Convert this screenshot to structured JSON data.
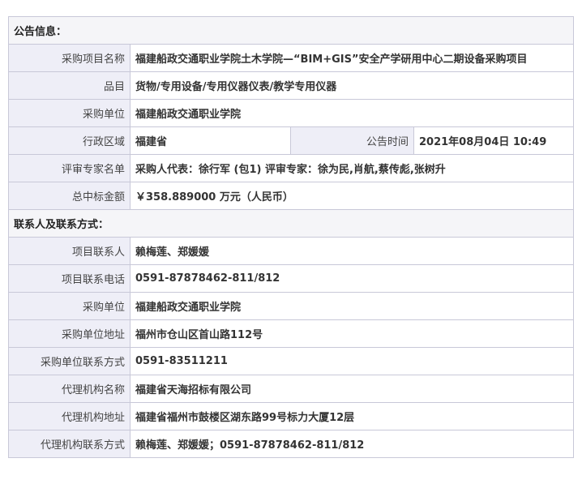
{
  "announcement": {
    "section_title": "公告信息：",
    "project_name_label": "采购项目名称",
    "project_name": "福建船政交通职业学院土木学院—“BIM+GIS”安全产学研用中心二期设备采购项目",
    "category_label": "品目",
    "category": "货物/专用设备/专用仪器仪表/教学专用仪器",
    "buyer_label": "采购单位",
    "buyer": "福建船政交通职业学院",
    "region_label": "行政区域",
    "region": "福建省",
    "publish_time_label": "公告时间",
    "publish_time": "2021年08月04日 10:49",
    "experts_label": "评审专家名单",
    "experts": "采购人代表：徐行军 (包1) 评审专家：徐为民,肖航,蔡传彪,张树升",
    "total_amount_label": "总中标金额",
    "total_amount": "￥358.889000 万元（人民币）"
  },
  "contact": {
    "section_title": "联系人及联系方式：",
    "project_contact_label": "项目联系人",
    "project_contact": "赖梅莲、郑媛媛",
    "project_phone_label": "项目联系电话",
    "project_phone": "0591-87878462-811/812",
    "buyer_label": "采购单位",
    "buyer": "福建船政交通职业学院",
    "buyer_address_label": "采购单位地址",
    "buyer_address": "福州市仓山区首山路112号",
    "buyer_contact_label": "采购单位联系方式",
    "buyer_contact": "0591-83511211",
    "agency_name_label": "代理机构名称",
    "agency_name": "福建省天海招标有限公司",
    "agency_address_label": "代理机构地址",
    "agency_address": "福建省福州市鼓楼区湖东路99号标力大厦12层",
    "agency_contact_label": "代理机构联系方式",
    "agency_contact": "赖梅莲、郑媛媛；0591-87878462-811/812"
  }
}
